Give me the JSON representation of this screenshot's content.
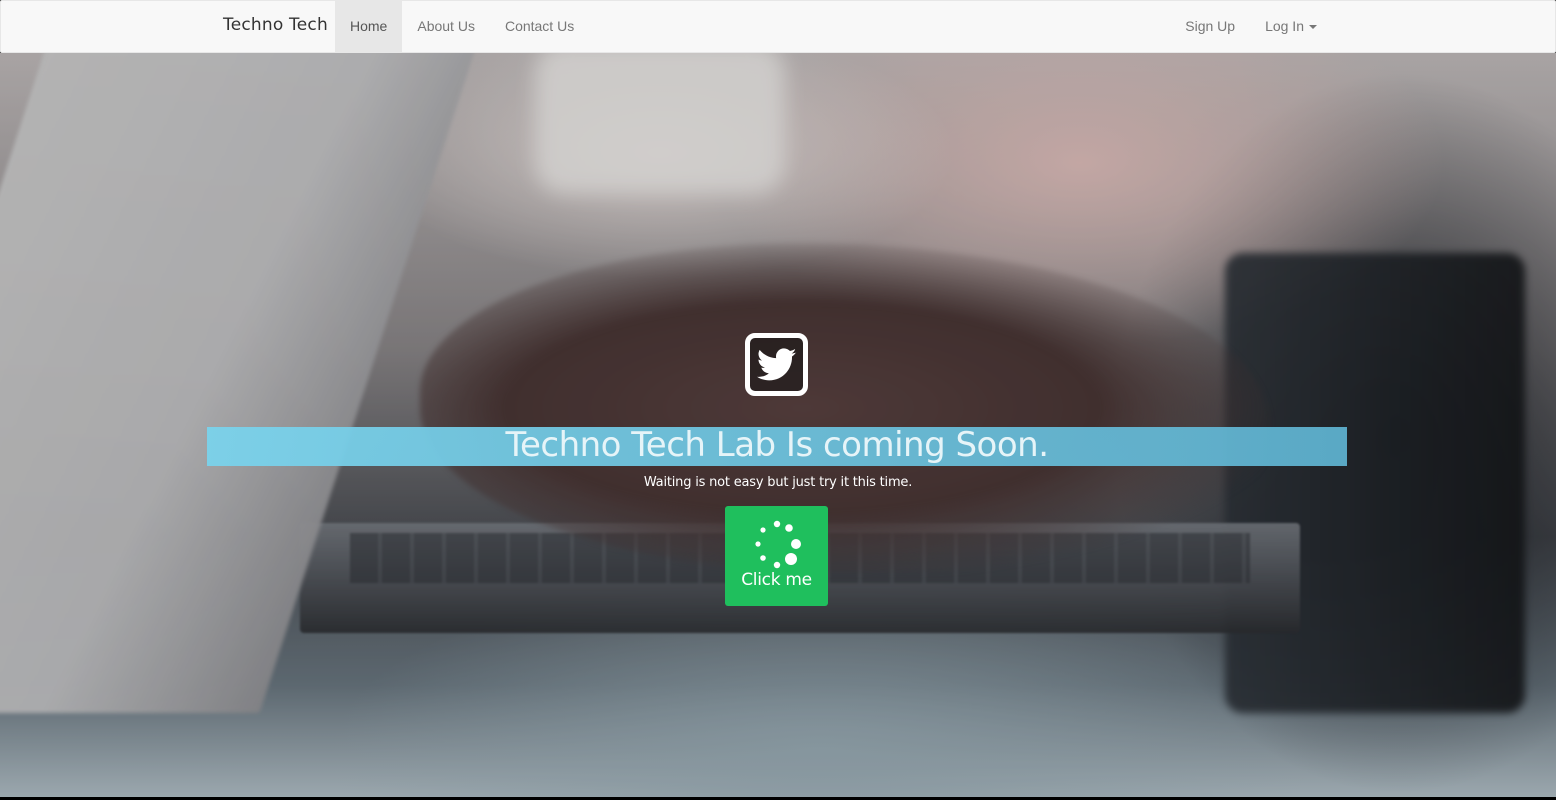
{
  "navbar": {
    "brand": "Techno Tech",
    "left_links": [
      {
        "label": "Home",
        "active": true
      },
      {
        "label": "About Us",
        "active": false
      },
      {
        "label": "Contact Us",
        "active": false
      }
    ],
    "right_links": [
      {
        "label": "Sign Up"
      },
      {
        "label": "Log In"
      }
    ]
  },
  "hero": {
    "icon": "twitter-icon",
    "headline": "Techno Tech Lab Is coming Soon.",
    "subtitle": "Waiting is not easy but just try it this time.",
    "button_label": "Click me",
    "button_icon": "spinner-icon"
  },
  "colors": {
    "navbar_bg": "#f8f8f8",
    "headline_bar": "#7ad2eb",
    "button_bg": "#1fbf5d",
    "icon_border": "#ffffff"
  }
}
